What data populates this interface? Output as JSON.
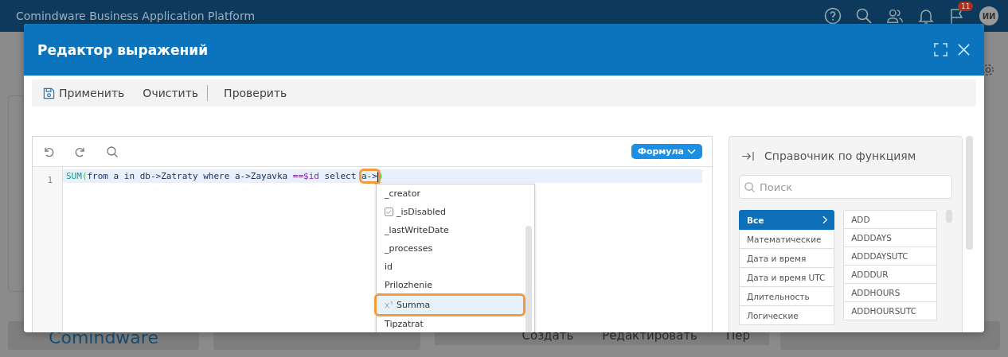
{
  "app_bar": {
    "title": "Comindware Business Application Platform",
    "notification_badge": "11",
    "avatar": "ИИ"
  },
  "background": {
    "logo": "Comindware",
    "buttons": [
      "Создать",
      "Редактировать",
      "Пер"
    ]
  },
  "dialog": {
    "title": "Редактор выражений",
    "toolbar": [
      {
        "label": "Применить",
        "kind": "save"
      },
      {
        "label": "Очистить",
        "kind": "plain"
      },
      {
        "label": "Проверить",
        "kind": "plain"
      }
    ],
    "editor": {
      "mode_button": "Формула",
      "line_number": "1",
      "code": [
        {
          "text": "SUM",
          "kind": "func"
        },
        {
          "text": "(",
          "kind": "paren"
        },
        {
          "text": "from a in db->Zatraty where a->Zayavka ",
          "kind": "plain"
        },
        {
          "text": "==$id",
          "kind": "op"
        },
        {
          "text": " select ",
          "kind": "plain"
        },
        {
          "text": "a->",
          "kind": "plain"
        },
        {
          "text": ")",
          "kind": "paren"
        }
      ],
      "suggestions": [
        {
          "label": "_creator",
          "kind": "plain",
          "selected": false
        },
        {
          "label": "_isDisabled",
          "kind": "checkbox",
          "selected": false
        },
        {
          "label": "_lastWriteDate",
          "kind": "plain",
          "selected": false
        },
        {
          "label": "_processes",
          "kind": "plain",
          "selected": false
        },
        {
          "label": "id",
          "kind": "plain",
          "selected": false
        },
        {
          "label": "Prilozhenie",
          "kind": "plain",
          "selected": false
        },
        {
          "label": "Summa",
          "kind": "number",
          "selected": true
        },
        {
          "label": "Tipzatrat",
          "kind": "plain",
          "selected": false
        }
      ]
    },
    "reference": {
      "title": "Справочник по функциям",
      "search": {
        "placeholder": "Поиск"
      },
      "categories": [
        {
          "label": "Все",
          "selected": true
        },
        {
          "label": "Математические",
          "selected": false
        },
        {
          "label": "Дата и время",
          "selected": false
        },
        {
          "label": "Дата и время UTC",
          "selected": false
        },
        {
          "label": "Длительность",
          "selected": false
        },
        {
          "label": "Логические",
          "selected": false
        }
      ],
      "functions": [
        "ADD",
        "ADDDAYS",
        "ADDDAYSUTC",
        "ADDDUR",
        "ADDHOURS",
        "ADDHOURSUTC"
      ]
    }
  }
}
